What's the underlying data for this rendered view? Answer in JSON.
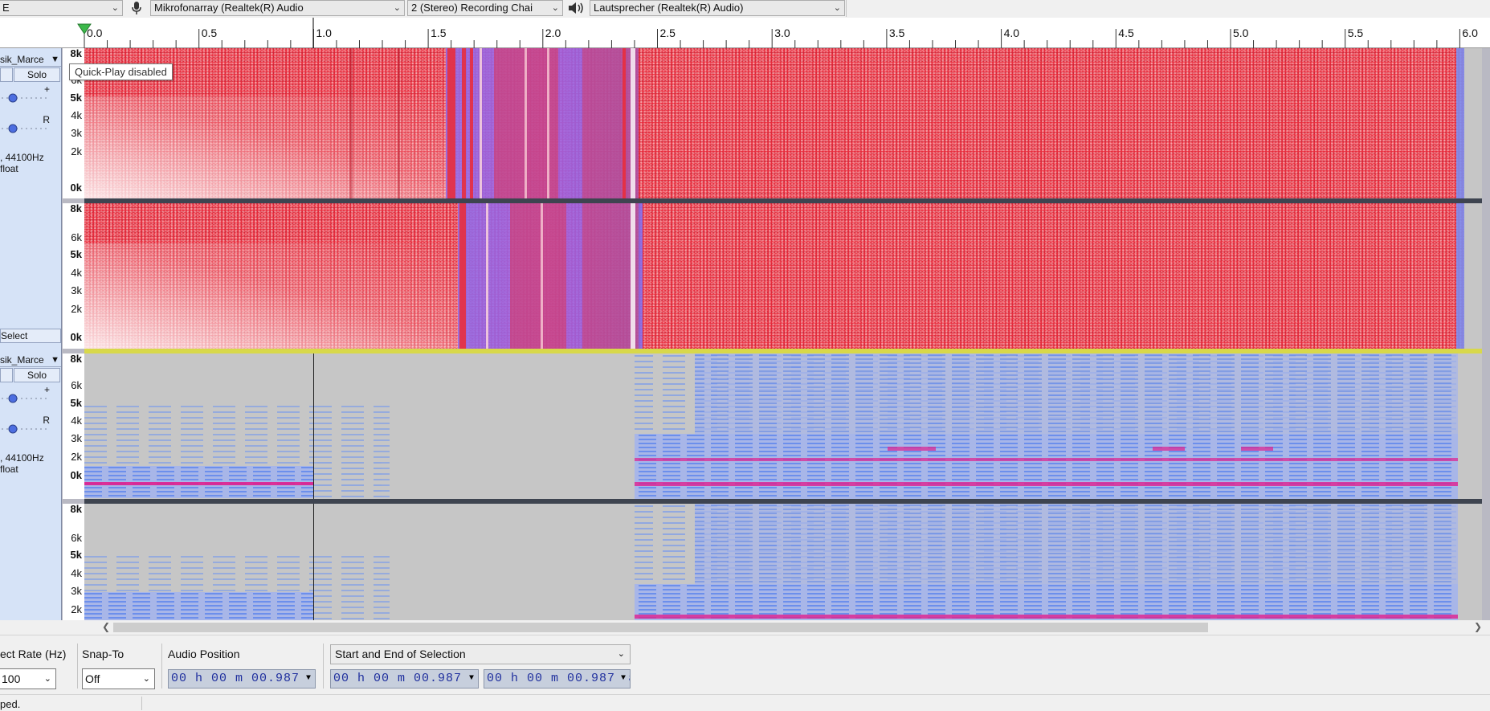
{
  "device_toolbar": {
    "host_combo": "E",
    "mic_device": "Mikrofonarray (Realtek(R) Audio",
    "channels": "2 (Stereo) Recording Chai",
    "speaker_device": "Lautsprecher (Realtek(R) Audio)"
  },
  "ruler": {
    "ticks": [
      "0.0",
      "0.5",
      "1.0",
      "1.5",
      "2.0",
      "2.5",
      "3.0",
      "3.5",
      "4.0",
      "4.5",
      "5.0",
      "5.5",
      "6.0"
    ]
  },
  "tooltip": "Quick-Play disabled",
  "tracks": [
    {
      "name": "sik_Marce",
      "solo_label": "Solo",
      "gain_plus": "+",
      "pan_r": "R",
      "info_line1": ", 44100Hz",
      "info_line2": "float",
      "select_label": "Select",
      "scale": [
        "8k",
        "6k",
        "5k",
        "4k",
        "3k",
        "2k",
        "0k"
      ],
      "scale2": [
        "8k",
        "6k",
        "5k",
        "4k",
        "3k",
        "2k",
        "0k"
      ]
    },
    {
      "name": "sik_Marce",
      "solo_label": "Solo",
      "gain_plus": "+",
      "pan_r": "R",
      "info_line1": ", 44100Hz",
      "info_line2": "float",
      "scale": [
        "8k",
        "6k",
        "5k",
        "4k",
        "3k",
        "2k",
        "0k"
      ],
      "scale2": [
        "8k",
        "6k",
        "5k",
        "4k",
        "3k",
        "2k"
      ]
    }
  ],
  "selection_toolbar": {
    "rate_label": "ect Rate (Hz)",
    "rate_value": "100",
    "snap_label": "Snap-To",
    "snap_value": "Off",
    "audio_position_label": "Audio Position",
    "selection_mode": "Start and End of Selection",
    "audio_position": "00 h 00 m 00.987 s",
    "selection_start": "00 h 00 m 00.987 s",
    "selection_end": "00 h 00 m 00.987 s"
  },
  "status": "ped.",
  "colors": {
    "spectrum_hot": "#e82d3d",
    "spectrum_cool": "#7b8df0",
    "spectrum_magenta": "#e0208f",
    "background_grey": "#c6c6c6",
    "track_panel": "#d6e3f7",
    "time_text": "#1f2f9e"
  }
}
